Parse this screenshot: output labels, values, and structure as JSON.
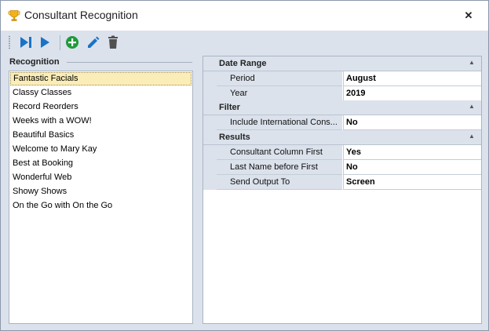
{
  "window": {
    "title": "Consultant Recognition",
    "close_label": "✕"
  },
  "toolbar": {
    "buttons": [
      {
        "icon": "run-to-end-icon",
        "color": "#1a73c6"
      },
      {
        "icon": "play-icon",
        "color": "#1a73c6"
      },
      {
        "icon": "add-icon",
        "color": "#1e9a3a"
      },
      {
        "icon": "edit-icon",
        "color": "#1a73c6"
      },
      {
        "icon": "delete-icon",
        "color": "#505050"
      }
    ]
  },
  "recognition": {
    "header": "Recognition",
    "items": [
      "Fantastic Facials",
      "Classy Classes",
      "Record Reorders",
      "Weeks with a WOW!",
      "Beautiful Basics",
      "Welcome to Mary Kay",
      "Best at Booking",
      "Wonderful Web",
      "Showy Shows",
      "On the Go with On the Go"
    ],
    "selected_index": 0
  },
  "properties": {
    "date_range": {
      "label": "Date Range",
      "period": {
        "name": "Period",
        "value": "August"
      },
      "year": {
        "name": "Year",
        "value": "2019"
      }
    },
    "filter": {
      "label": "Filter",
      "intl": {
        "name": "Include International Cons...",
        "value": "No"
      }
    },
    "results": {
      "label": "Results",
      "consultant_first": {
        "name": "Consultant Column First",
        "value": "Yes"
      },
      "last_name_first": {
        "name": "Last Name before First",
        "value": "No"
      },
      "send_output": {
        "name": "Send Output To",
        "value": "Screen"
      }
    },
    "collapse_glyph": "▲"
  }
}
